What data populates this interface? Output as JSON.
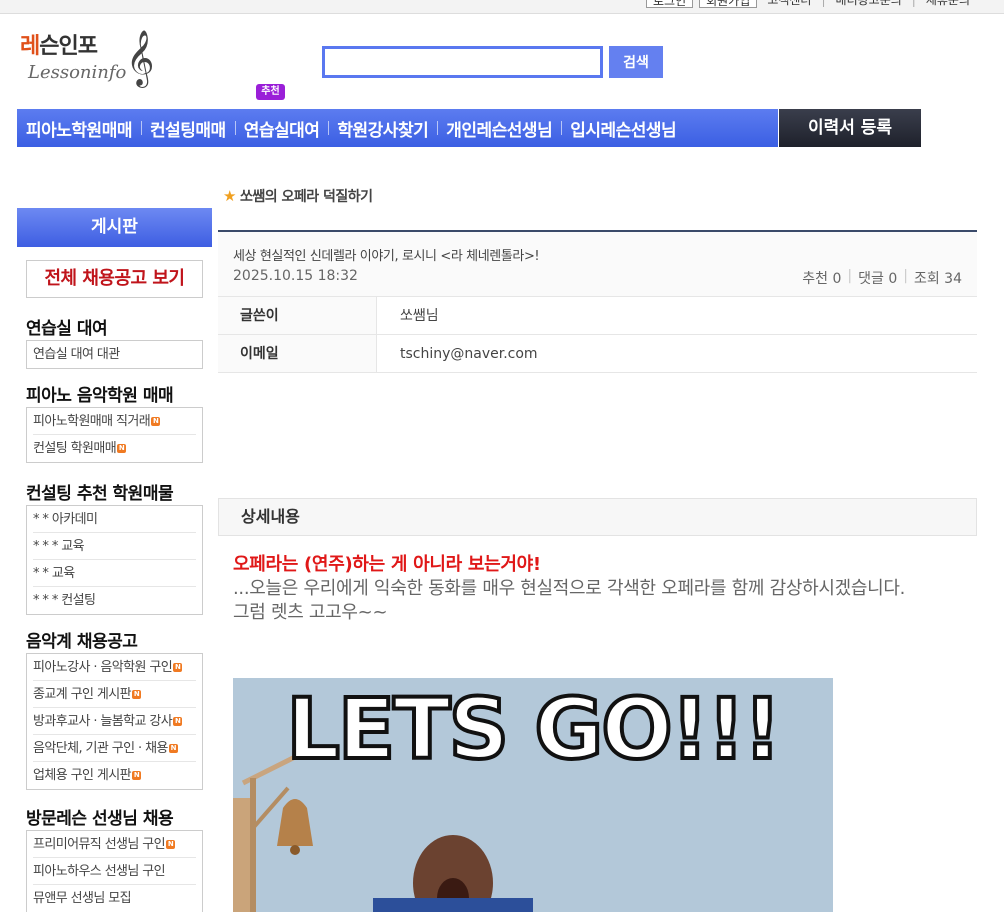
{
  "top_links": [
    "로그인",
    "회원가입",
    "고객센터",
    "배너광고문의",
    "제휴문의"
  ],
  "logo": {
    "kr_red": "레",
    "kr_rest": "슨인포",
    "en": "Lessoninfo",
    "clef": "𝄞",
    "alt": "레슨인포 Lessoninfo"
  },
  "search": {
    "value": "",
    "placeholder": "",
    "button_label": "검색"
  },
  "recommend_badge": "추천",
  "nav": {
    "items": [
      "피아노학원매매",
      "컨설팅매매",
      "연습실대여",
      "학원강사찾기",
      "개인레슨선생님",
      "입시레슨선생님"
    ],
    "resume": "이력서 등록"
  },
  "sidebar": {
    "title": "게시판",
    "jobs_all": "전체 채용공고 보기",
    "sections": [
      {
        "title": "연습실 대여",
        "items": [
          {
            "label": "연습실 대여 대관",
            "new": false
          }
        ]
      },
      {
        "title": "피아노 음악학원 매매",
        "items": [
          {
            "label": "피아노학원매매 직거래",
            "new": true
          },
          {
            "label": "컨설팅 학원매매",
            "new": true
          }
        ]
      },
      {
        "title": "컨설팅 추천 학원매물",
        "items": [
          {
            "label": "* * 아카데미",
            "new": false
          },
          {
            "label": "* * * 교육",
            "new": false
          },
          {
            "label": "* * 교육",
            "new": false
          },
          {
            "label": "* * * 컨설팅",
            "new": false
          }
        ]
      },
      {
        "title": "음악계 채용공고",
        "items": [
          {
            "label": "피아노강사 · 음악학원 구인",
            "new": true
          },
          {
            "label": "종교계 구인 게시판",
            "new": true
          },
          {
            "label": "방과후교사 · 늘봄학교 강사",
            "new": true
          },
          {
            "label": "음악단체, 기관 구인 · 채용",
            "new": true
          },
          {
            "label": "업체용 구인 게시판",
            "new": true
          }
        ]
      },
      {
        "title": "방문레슨 선생님 채용",
        "items": [
          {
            "label": "프리미어뮤직 선생님 구인",
            "new": true
          },
          {
            "label": "피아노하우스 선생님 구인",
            "new": false
          },
          {
            "label": "뮤앤무 선생님 모집",
            "new": false
          }
        ]
      }
    ]
  },
  "board": {
    "title": "쏘쌤의 오페라 덕질하기"
  },
  "post": {
    "title": "세상 현실적인 신데렐라 이야기, 로시니 <라 체네렌톨라>!",
    "date": "2025.10.15 18:32",
    "recommend": "추천 0",
    "comments": "댓글 0",
    "views": "조회 34",
    "author_label": "글쓴이",
    "author": "쏘쌤님",
    "email_label": "이메일",
    "email": "tschiny@naver.com"
  },
  "detail": {
    "heading": "상세내용",
    "headline": "오페라는 (연주)하는 게 아니라 보는거야!",
    "line1": "...오늘은 우리에게 익숙한 동화를 매우 현실적으로 각색한 오페라를 함께 감상하시겠습니다.",
    "line2": "그럼 렛츠 고고우~~",
    "gif_text": "LETS GO!!!"
  },
  "colors": {
    "nav_blue": "#4a6cea",
    "accent_red": "#e01818",
    "resume_dark": "#262a35",
    "badge_purple": "#9a1fd8"
  }
}
